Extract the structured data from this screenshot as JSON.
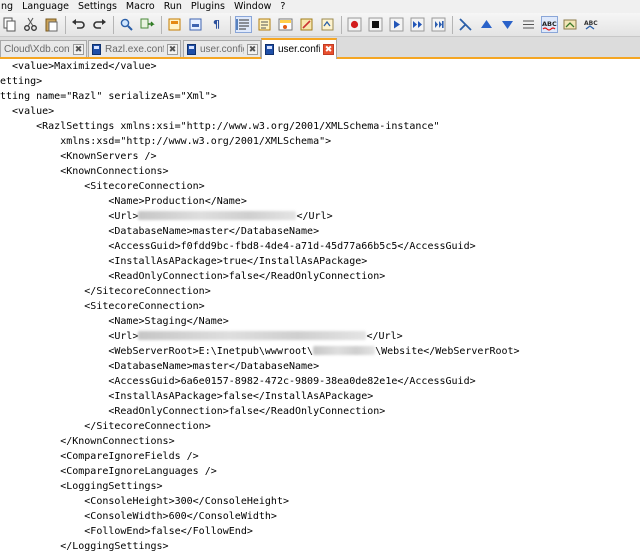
{
  "menu": [
    "ng",
    "Language",
    "Settings",
    "Macro",
    "Run",
    "Plugins",
    "Window",
    "?"
  ],
  "toolbar": {
    "icons": [
      "copy-icon",
      "cut-icon",
      "paste-icon",
      "undo-icon",
      "redo-icon",
      "find-icon",
      "replace-icon",
      "zoom-in-icon",
      "zoom-out-icon",
      "sync-vertical-icon",
      "sync-horizontal-icon",
      "word-wrap-icon",
      "show-all-characters-icon",
      "indent-guide-icon",
      "document-map-icon",
      "function-list-icon",
      "folder-as-workspace-icon",
      "monitoring-icon",
      "record-macro-icon",
      "stop-recording-icon",
      "play-macro-icon",
      "play-multiple-icon",
      "save-macro-icon",
      "comment-icon",
      "up-icon",
      "down-icon",
      "fold-icon",
      "spell-check-icon",
      "spell-next-icon",
      "spell-settings-icon"
    ]
  },
  "tabs": [
    {
      "label": "Cloud\\Xdb.config",
      "active": false
    },
    {
      "label": "Razl.exe.config",
      "active": false
    },
    {
      "label": "user.config",
      "active": false
    },
    {
      "label": "user.config",
      "active": true
    }
  ],
  "close_glyph": "✖",
  "code_lines": [
    "  <value>Maximized</value>",
    "etting>",
    "tting name=\"Razl\" serializeAs=\"Xml\">",
    "  <value>",
    "      <RazlSettings xmlns:xsi=\"http://www.w3.org/2001/XMLSchema-instance\"",
    "          xmlns:xsd=\"http://www.w3.org/2001/XMLSchema\">",
    "          <KnownServers />",
    "          <KnownConnections>",
    "              <SitecoreConnection>",
    "                  <Name>Production</Name>",
    "                  <Url>",
    "                  <DatabaseName>master</DatabaseName>",
    "                  <AccessGuid>f0fdd9bc-fbd8-4de4-a71d-45d77a66b5c5</AccessGuid>",
    "                  <InstallAsAPackage>true</InstallAsAPackage>",
    "                  <ReadOnlyConnection>false</ReadOnlyConnection>",
    "              </SitecoreConnection>",
    "              <SitecoreConnection>",
    "                  <Name>Staging</Name>",
    "                  <Url>",
    "                  <WebServerRoot>E:\\Inetpub\\wwwroot\\",
    "                  <DatabaseName>master</DatabaseName>",
    "                  <AccessGuid>6a6e0157-8982-472c-9809-38ea0de82e1e</AccessGuid>",
    "                  <InstallAsAPackage>false</InstallAsAPackage>",
    "                  <ReadOnlyConnection>false</ReadOnlyConnection>",
    "              </SitecoreConnection>",
    "          </KnownConnections>",
    "          <CompareIgnoreFields />",
    "          <CompareIgnoreLanguages />",
    "          <LoggingSettings>",
    "              <ConsoleHeight>300</ConsoleHeight>",
    "              <ConsoleWidth>600</ConsoleWidth>",
    "              <FollowEnd>false</FollowEnd>",
    "          </LoggingSettings>"
  ],
  "line_tails": {
    "url_close": "</Url>",
    "webroot_tail": "\\Website</WebServerRoot>"
  },
  "colors": {
    "tab_accent": "#f5a623",
    "close_active": "#e8502f"
  }
}
